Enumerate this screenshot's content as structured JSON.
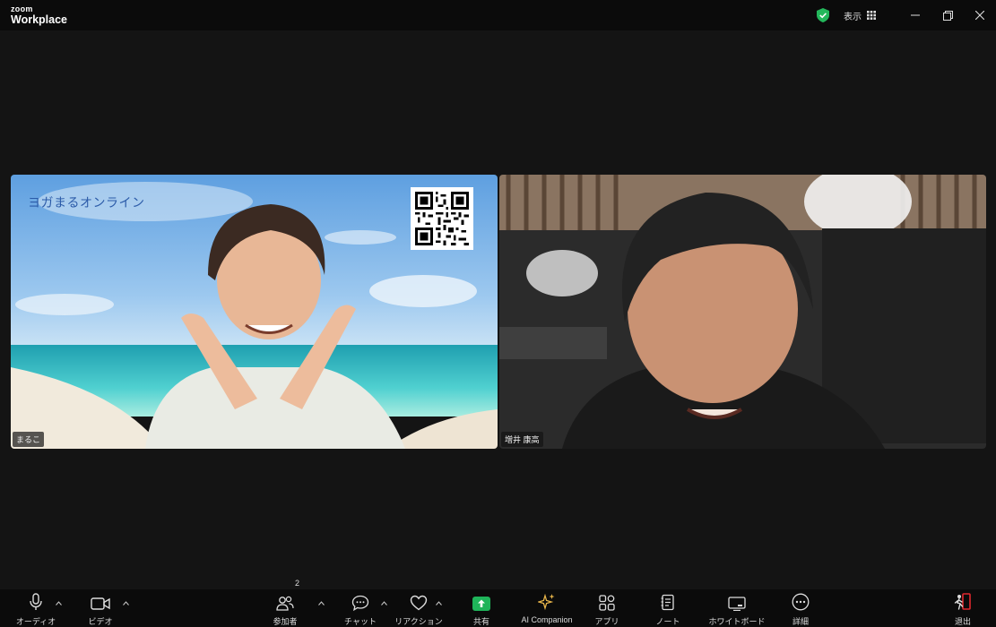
{
  "titlebar": {
    "logo_small": "zoom",
    "logo_main": "Workplace",
    "view_label": "表示"
  },
  "video": {
    "left": {
      "background_title": "ヨガまるオンライン",
      "name": "まるこ"
    },
    "right": {
      "name": "増井 康高"
    }
  },
  "toolbar": {
    "audio": "オーディオ",
    "video": "ビデオ",
    "participants": "参加者",
    "participants_count": "2",
    "chat": "チャット",
    "reactions": "リアクション",
    "share": "共有",
    "ai_companion": "AI Companion",
    "apps": "アプリ",
    "notes": "ノート",
    "whiteboard": "ホワイトボード",
    "more": "詳細",
    "leave": "退出"
  },
  "colors": {
    "share_green": "#1fb45a",
    "leave_red": "#e0282e",
    "shield_green": "#23b75b"
  }
}
